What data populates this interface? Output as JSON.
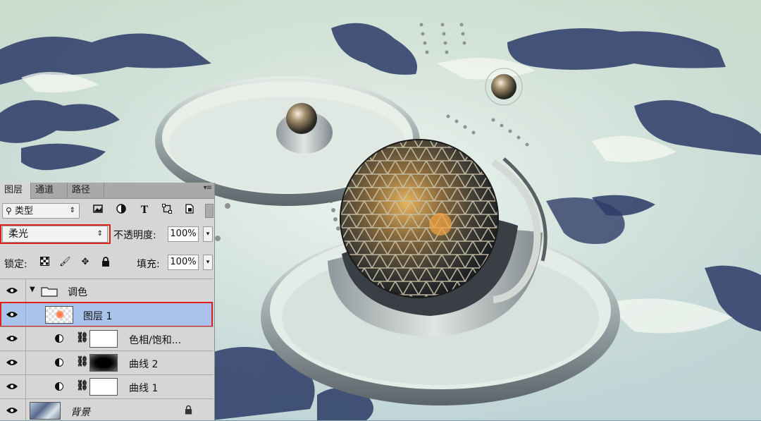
{
  "panel": {
    "tabs": [
      {
        "label": "图层",
        "active": true
      },
      {
        "label": "通道",
        "active": false
      },
      {
        "label": "路径",
        "active": false
      }
    ],
    "filter": {
      "label": "类型",
      "icon": "search-icon"
    },
    "filter_icons": [
      "image-filter-icon",
      "adjustment-filter-icon",
      "type-filter-icon",
      "shape-filter-icon",
      "smart-object-filter-icon"
    ],
    "blend_mode": "柔光",
    "opacity_label": "不透明度:",
    "opacity_value": "100%",
    "lock_label": "锁定:",
    "fill_label": "填充:",
    "fill_value": "100%",
    "highlight_color": "#e0201c",
    "selection_color": "#a9c3ea",
    "layers": [
      {
        "name": "调色",
        "type": "group",
        "visible": true,
        "expanded": true
      },
      {
        "name": "图层 1",
        "type": "pixel",
        "visible": true,
        "selected": true
      },
      {
        "name": "色相/饱和...",
        "type": "adjustment",
        "visible": true
      },
      {
        "name": "曲线 2",
        "type": "adjustment",
        "visible": true
      },
      {
        "name": "曲线 1",
        "type": "adjustment",
        "visible": true
      },
      {
        "name": "背景",
        "type": "background",
        "visible": true,
        "locked": true
      }
    ]
  }
}
